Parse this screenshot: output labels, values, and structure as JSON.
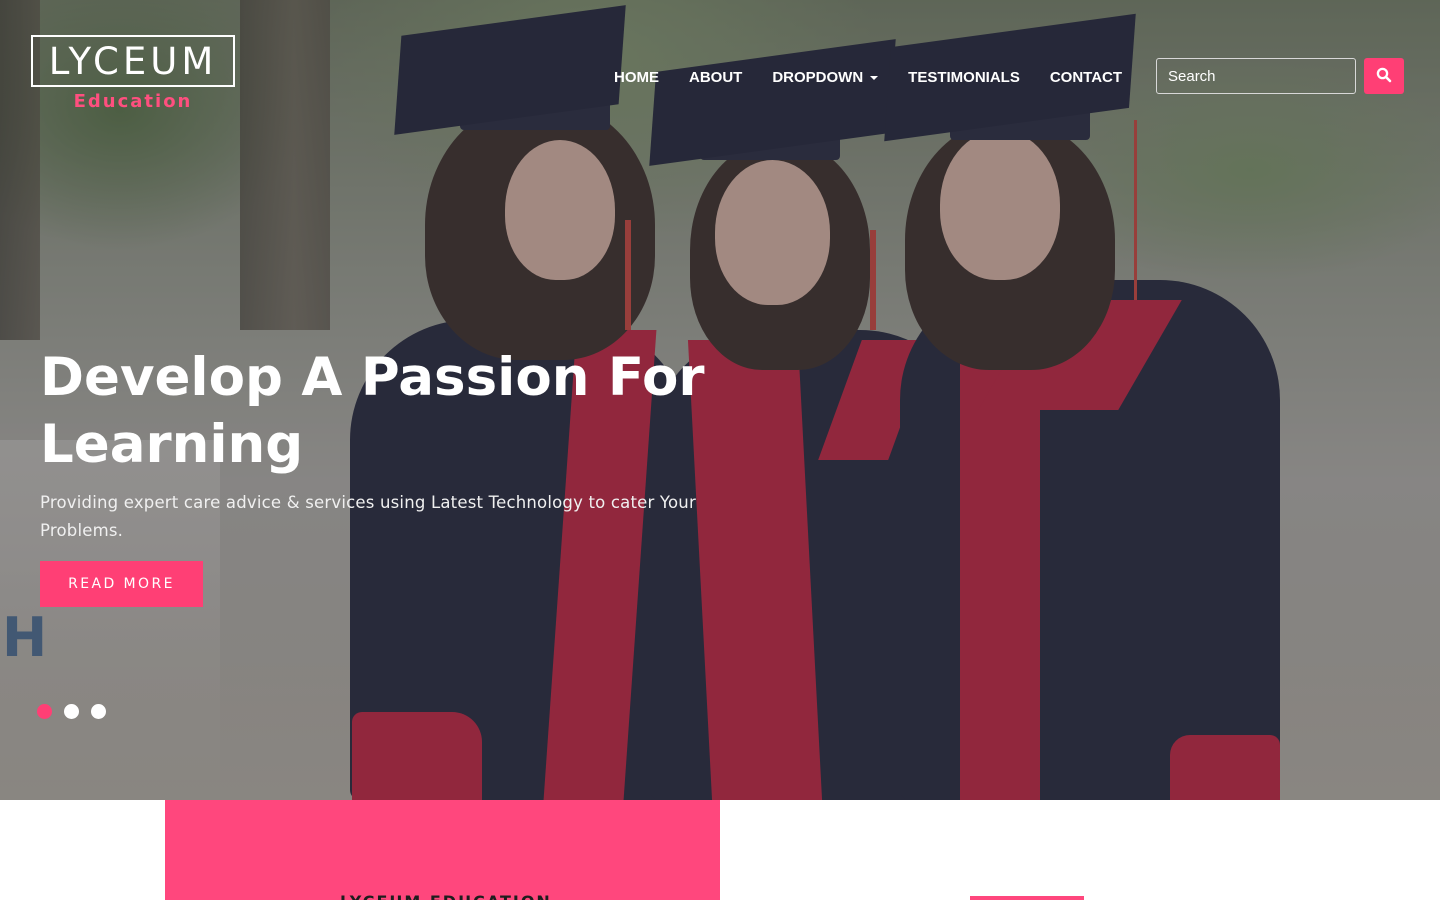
{
  "brand": {
    "title": "LYCEUM",
    "subtitle": "Education"
  },
  "nav": {
    "items": [
      {
        "label": "HOME"
      },
      {
        "label": "ABOUT"
      },
      {
        "label": "DROPDOWN"
      },
      {
        "label": "TESTIMONIALS"
      },
      {
        "label": "CONTACT"
      }
    ]
  },
  "search": {
    "placeholder": "Search",
    "button_icon": "search-icon"
  },
  "hero": {
    "title": "Develop A Passion For Learning",
    "subtitle": "Providing expert care advice & services using Latest Technology to cater Your Problems.",
    "button_label": "READ MORE",
    "slides_total": 3,
    "active_slide": 1
  },
  "section": {
    "heading": "LYCEUM EDUCATION"
  },
  "colors": {
    "accent": "#ff3f75",
    "brand_sub": "#ff4f7f",
    "panel": "#ff477d"
  }
}
